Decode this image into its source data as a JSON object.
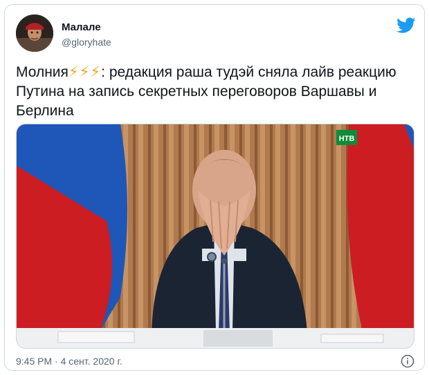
{
  "author": {
    "name": "Малале",
    "handle": "@gloryhate"
  },
  "tweet": {
    "text_prefix": "Молния",
    "bolts": "⚡⚡⚡",
    "text_body": ": редакция раша тудэй сняла лайв реакцию Путина на запись секретных переговоров Варшавы и Берлина"
  },
  "media": {
    "watermark": "НТВ",
    "colors": {
      "flag_blue": "#1f57b8",
      "flag_red": "#cc1d23",
      "curtain": "#b07a4e",
      "suit": "#1b2433"
    }
  },
  "meta": {
    "timestamp": "9:45 PM · 4 сент. 2020 г."
  },
  "icons": {
    "brand": "twitter-bird-icon",
    "info": "info-icon"
  }
}
